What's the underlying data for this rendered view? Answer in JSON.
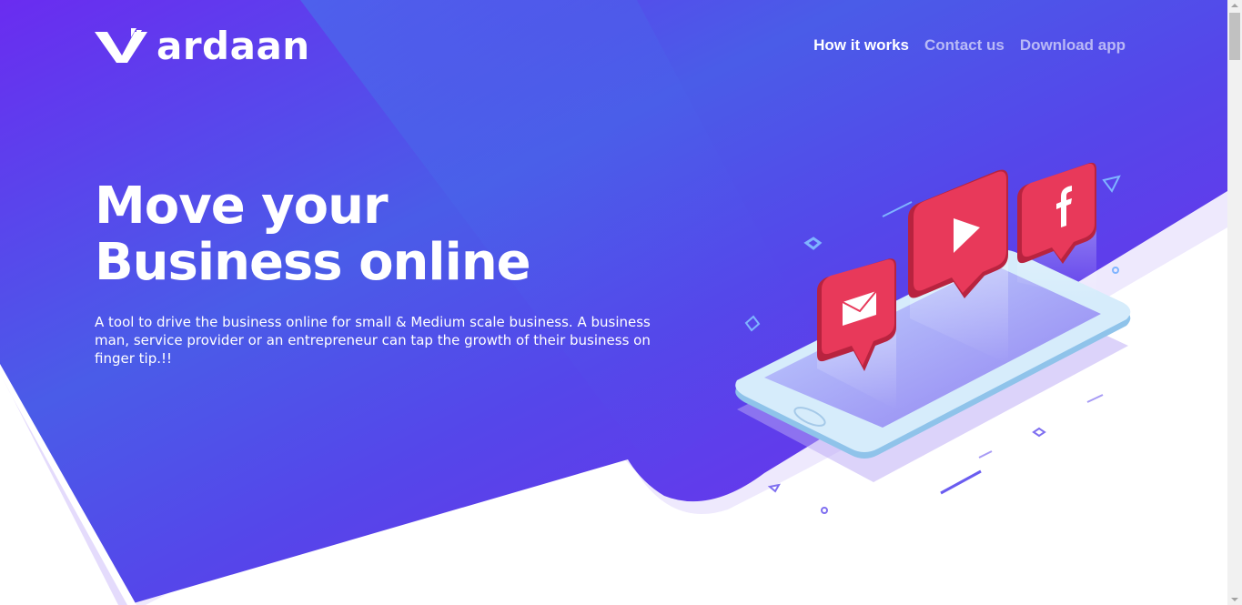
{
  "brand": {
    "name": "ardaan",
    "logo_mark": "vardaan-v-logo",
    "accent": "#6a2cf0",
    "secondary": "#3a6fe8"
  },
  "nav": {
    "items": [
      {
        "label": "How it works",
        "active": true
      },
      {
        "label": "Contact us",
        "active": false
      },
      {
        "label": "Download app",
        "active": false
      }
    ]
  },
  "hero": {
    "title_line1": "Move your",
    "title_line2": "Business online",
    "description": "A tool to drive the business online for small & Medium scale business. A business man, service provider or an entrepreneur can tap the growth of their business on finger tip.!!"
  },
  "illustration": {
    "icons": [
      "mail-icon",
      "play-icon",
      "facebook-icon"
    ],
    "bubble_color": "#e8395a"
  }
}
